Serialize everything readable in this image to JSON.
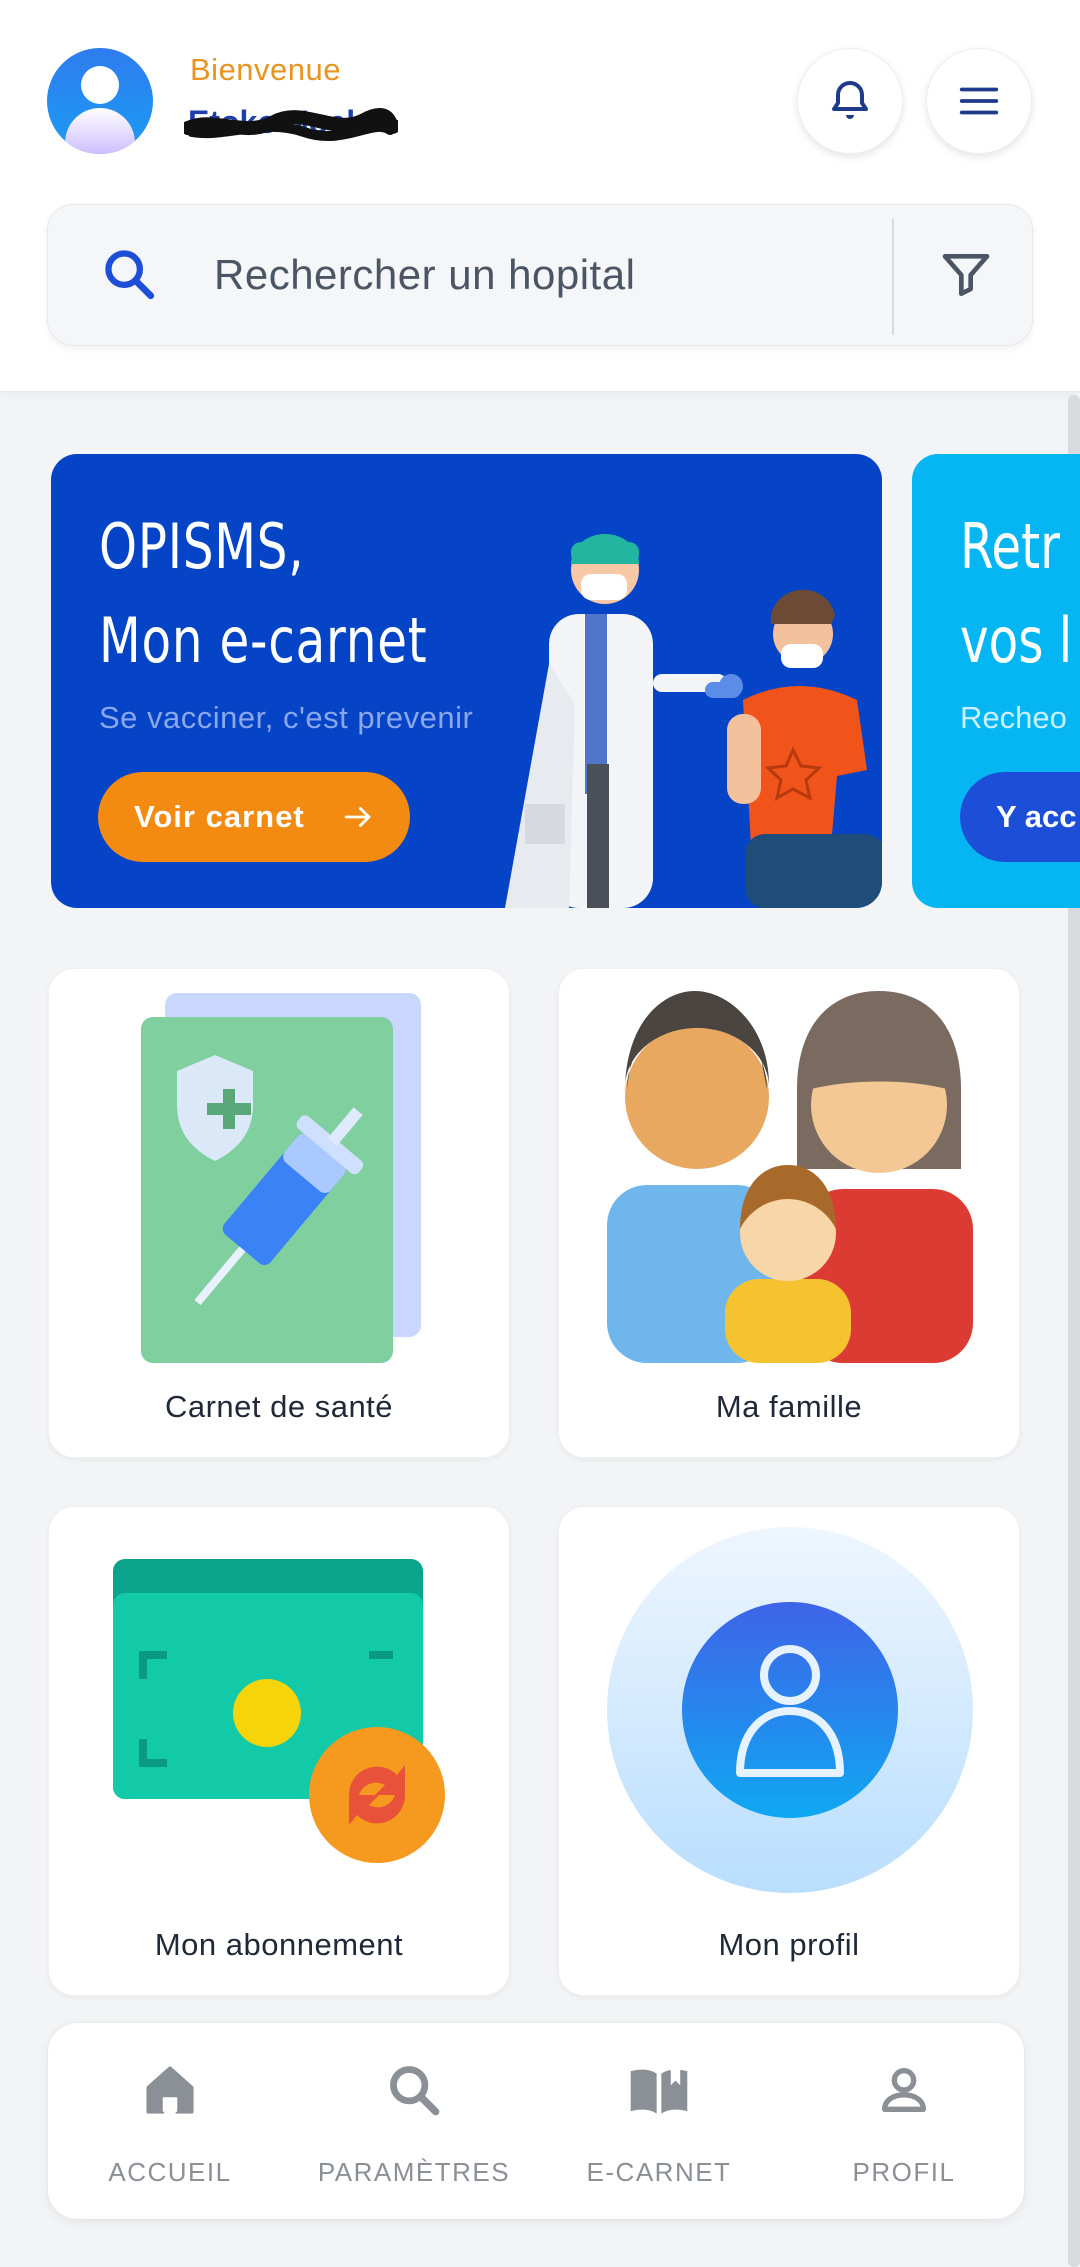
{
  "header": {
    "welcome": "Bienvenue",
    "username": "Etoko Noel",
    "notifications_icon": "bell-icon",
    "menu_icon": "hamburger-menu-icon"
  },
  "search": {
    "placeholder": "Rechercher un hopital",
    "icon": "search-icon",
    "filter_icon": "filter-icon"
  },
  "banners": [
    {
      "title_line1": "OPISMS,",
      "title_line2": "Mon e-carnet",
      "subtitle": "Se vacciner, c'est prevenir",
      "cta": "Voir carnet",
      "cta_icon": "arrow-right-icon",
      "color": "#0544c6"
    },
    {
      "title_line1": "Retr",
      "title_line2": "vos l",
      "subtitle": "Recheo",
      "cta": "Y acc",
      "color": "#06b6f2"
    }
  ],
  "tiles": [
    {
      "label": "Carnet de santé",
      "icon": "health-record-vaccine-icon"
    },
    {
      "label": "Ma famille",
      "icon": "family-icon"
    },
    {
      "label": "Mon abonnement",
      "icon": "subscription-renewal-icon"
    },
    {
      "label": "Mon profil",
      "icon": "profile-icon"
    }
  ],
  "nav": [
    {
      "label": "ACCUEIL",
      "icon": "home-icon"
    },
    {
      "label": "PARAMÈTRES",
      "icon": "search-icon"
    },
    {
      "label": "E-CARNET",
      "icon": "book-icon"
    },
    {
      "label": "PROFIL",
      "icon": "person-icon"
    }
  ],
  "colors": {
    "primary": "#0544c6",
    "accent": "#f38a12",
    "welcome": "#e8941f"
  }
}
